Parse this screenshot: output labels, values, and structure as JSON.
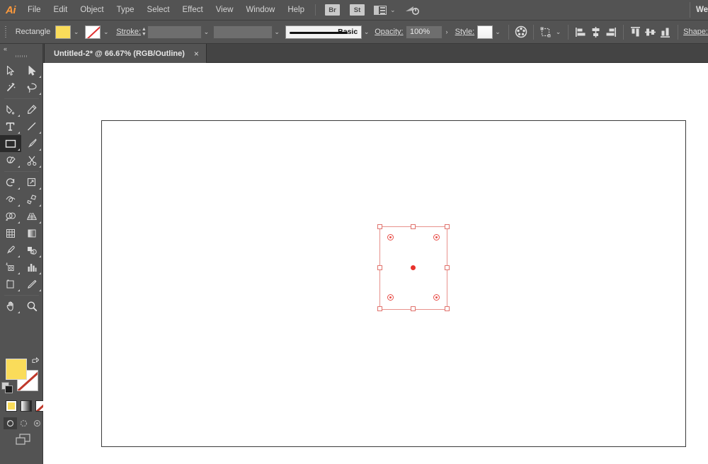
{
  "app": {
    "name": "Adobe Illustrator",
    "logo_text": "Ai",
    "accent_color": "#ff9a3c",
    "ui_background": "#535353",
    "canvas_background": "#ffffff"
  },
  "menubar": {
    "items": [
      {
        "label": "File"
      },
      {
        "label": "Edit"
      },
      {
        "label": "Object"
      },
      {
        "label": "Type"
      },
      {
        "label": "Select"
      },
      {
        "label": "Effect"
      },
      {
        "label": "View"
      },
      {
        "label": "Window"
      },
      {
        "label": "Help"
      }
    ],
    "bridge_badge": "Br",
    "stock_badge": "St",
    "arrange_documents_icon": "arrange-documents-icon",
    "arrange_chevron": "⌄",
    "sync_icon": "cloud-sync-icon",
    "workspace_label": "We"
  },
  "controlbar": {
    "object_type": "Rectangle",
    "fill_color": "#fadc5a",
    "fill_dropdown_chevron": "⌄",
    "stroke_color_label": "none",
    "stroke_dropdown_chevron": "⌄",
    "stroke_label": "Stroke:",
    "stroke_weight": "",
    "stroke_weight_dropdown_chevron": "⌄",
    "stroke_profile": "",
    "stroke_profile_chevron": "⌄",
    "brush_definition": "Basic",
    "brush_chevron": "⌄",
    "opacity_label": "Opacity:",
    "opacity_value": "100%",
    "opacity_more": "›",
    "style_label": "Style:",
    "style_color": "#ffffff",
    "style_chevron": "⌄",
    "recolor_icon": "recolor-artwork-icon",
    "transform_icon": "transform-icon",
    "transform_chevron": "⌄",
    "align_left_icon": "align-left-icon",
    "align_center_h_icon": "align-center-horizontal-icon",
    "align_right_icon": "align-right-icon",
    "align_top_icon": "align-top-icon",
    "align_center_v_icon": "align-center-vertical-icon",
    "align_bottom_icon": "align-bottom-icon",
    "shape_label": "Shape:"
  },
  "tabbar": {
    "document_title": "Untitled-2* @ 66.67% (RGB/Outline)",
    "close_glyph": "×"
  },
  "toolbar": {
    "collapse_glyph": "«",
    "tools": [
      {
        "name": "selection-tool",
        "label": "Selection"
      },
      {
        "name": "direct-selection-tool",
        "label": "Direct Selection"
      },
      {
        "name": "magic-wand-tool",
        "label": "Magic Wand"
      },
      {
        "name": "lasso-tool",
        "label": "Lasso"
      },
      {
        "name": "pen-tool",
        "label": "Pen"
      },
      {
        "name": "curvature-tool",
        "label": "Curvature"
      },
      {
        "name": "type-tool",
        "label": "Type"
      },
      {
        "name": "line-segment-tool",
        "label": "Line Segment"
      },
      {
        "name": "rectangle-tool",
        "label": "Rectangle",
        "active": true
      },
      {
        "name": "paintbrush-tool",
        "label": "Paintbrush"
      },
      {
        "name": "shaper-tool",
        "label": "Shaper"
      },
      {
        "name": "scissors-tool",
        "label": "Scissors"
      },
      {
        "name": "rotate-tool",
        "label": "Rotate"
      },
      {
        "name": "scale-tool",
        "label": "Scale"
      },
      {
        "name": "width-tool",
        "label": "Width"
      },
      {
        "name": "free-transform-tool",
        "label": "Free Transform"
      },
      {
        "name": "shape-builder-tool",
        "label": "Shape Builder"
      },
      {
        "name": "perspective-grid-tool",
        "label": "Perspective Grid"
      },
      {
        "name": "mesh-tool",
        "label": "Mesh"
      },
      {
        "name": "gradient-tool",
        "label": "Gradient"
      },
      {
        "name": "eyedropper-tool",
        "label": "Eyedropper"
      },
      {
        "name": "blend-tool",
        "label": "Blend"
      },
      {
        "name": "symbol-sprayer-tool",
        "label": "Symbol Sprayer"
      },
      {
        "name": "column-graph-tool",
        "label": "Column Graph"
      },
      {
        "name": "artboard-tool",
        "label": "Artboard"
      },
      {
        "name": "slice-tool",
        "label": "Slice"
      },
      {
        "name": "hand-tool",
        "label": "Hand"
      },
      {
        "name": "zoom-tool",
        "label": "Zoom"
      }
    ],
    "fill_color": "#fadc5a",
    "stroke_color": "none",
    "swap_icon": "swap-fill-stroke-icon",
    "default_colors_icon": "default-fill-stroke-icon",
    "color_mode": "color",
    "gradient_mode": "gradient",
    "none_mode": "none",
    "draw_normal_icon": "draw-normal-icon",
    "draw_behind_icon": "draw-behind-icon",
    "draw_inside_icon": "draw-inside-icon",
    "screen_mode_icon": "change-screen-mode-icon"
  },
  "canvas": {
    "zoom_level": "66.67%",
    "color_mode": "RGB",
    "view_mode": "Outline",
    "selection": {
      "shape": "rectangle",
      "handle_color": "#e0726c",
      "corner_widget_color": "#e8504a",
      "center_point_color": "#e8322c",
      "outline_color": "#2b2b2b",
      "handles": 8,
      "corner_widgets": 4
    }
  }
}
